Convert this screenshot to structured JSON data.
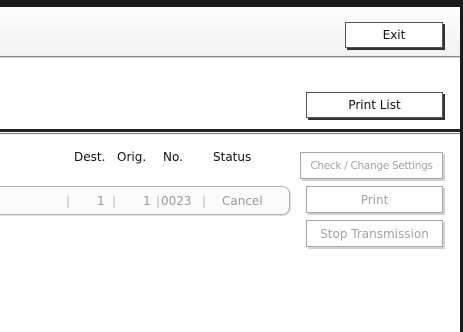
{
  "header": {
    "exit_label": "Exit"
  },
  "toolbar": {
    "print_list_label": "Print List"
  },
  "columns": {
    "dest": "Dest.",
    "orig": "Orig.",
    "no": "No.",
    "status": "Status"
  },
  "job_row": {
    "sep1": "|",
    "dest_value": "1",
    "sep2": "|",
    "orig_value": "1",
    "sep3": "|",
    "no_value": "0023",
    "sep4": "|",
    "status_value": "Cancel"
  },
  "actions": {
    "check_change_label": "Check / Change Settings",
    "print_label": "Print",
    "stop_label": "Stop Transmission"
  },
  "colors": {
    "frame": "#1a1a1a",
    "disabled_text": "#a3a3a3",
    "enabled_border": "#555555"
  }
}
